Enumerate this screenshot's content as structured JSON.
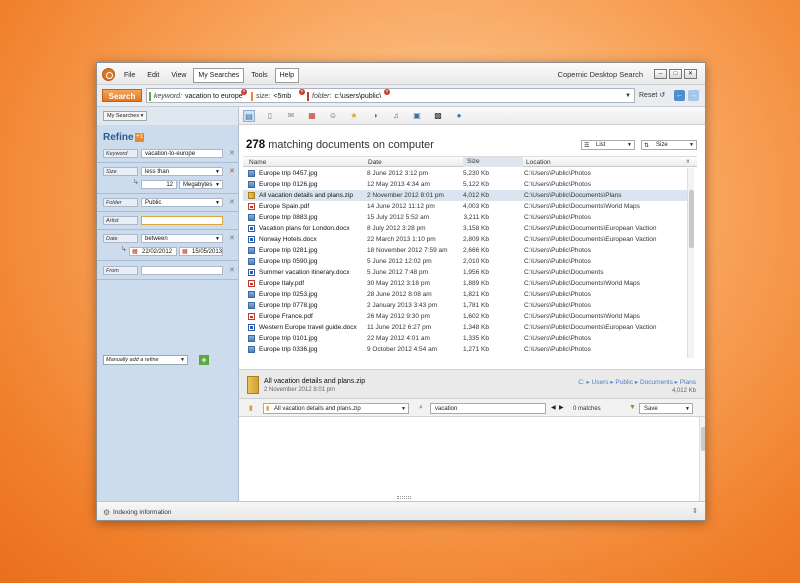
{
  "window": {
    "title": "Copernic Desktop Search",
    "menu": [
      "File",
      "Edit",
      "View",
      "My Searches",
      "Tools",
      "Help"
    ]
  },
  "search": {
    "button": "Search",
    "chips": [
      {
        "key": "keyword:",
        "value": "vacation to europe"
      },
      {
        "key": "size:",
        "value": "<5mb"
      },
      {
        "key": "folder:",
        "value": "c:\\users\\public\\"
      }
    ],
    "reset": "Reset"
  },
  "my_searches": "My Searches",
  "toolbar_icons": [
    "all-icon",
    "documents-icon",
    "emails-icon",
    "calendar-icon",
    "contacts-icon",
    "favorites-icon",
    "history-icon",
    "music-icon",
    "pictures-icon",
    "videos-icon",
    "web-icon"
  ],
  "refine": {
    "title": "Refine",
    "badge": "+1",
    "keyword": {
      "label": "Keyword",
      "value": "vacation-to-europe"
    },
    "size": {
      "label": "Size",
      "op": "less than",
      "amount": "12",
      "unit": "Megabytes"
    },
    "folder": {
      "label": "Folder",
      "value": "Public"
    },
    "artist": {
      "label": "Artist",
      "value": ""
    },
    "date": {
      "label": "Date",
      "op": "between",
      "from": "22/02/2012",
      "to": "15/05/2013"
    },
    "from": {
      "label": "From",
      "value": ""
    },
    "add": "Manually add a refine"
  },
  "results": {
    "count": "278",
    "count_text": "matching documents on computer",
    "view": "List",
    "sort": "Size",
    "columns": {
      "name": "Name",
      "date": "Date",
      "size": "Size",
      "location": "Location"
    },
    "rows": [
      {
        "type": "jpg",
        "name": "Europe trip 0457.jpg",
        "date": "8 June 2012  3:12 pm",
        "size": "5,230 Kb",
        "location": "C:\\Users\\Public\\Photos"
      },
      {
        "type": "jpg",
        "name": "Europe trip 0126.jpg",
        "date": "12 May 2013  4:34 am",
        "size": "5,122 Kb",
        "location": "C:\\Users\\Public\\Photos"
      },
      {
        "type": "zip",
        "name": "All vacation details and plans.zip",
        "date": "2 November 2012  8:01 pm",
        "size": "4,012 Kb",
        "location": "C:\\Users\\Public\\Documents\\Plans"
      },
      {
        "type": "pdf",
        "name": "Europe Spain.pdf",
        "date": "14 June 2012  11:12 pm",
        "size": "4,003 Kb",
        "location": "C:\\Users\\Public\\Documents\\World Maps"
      },
      {
        "type": "jpg",
        "name": "Europe trip 0883.jpg",
        "date": "15 July 2012  5:52 am",
        "size": "3,211 Kb",
        "location": "C:\\Users\\Public\\Photos"
      },
      {
        "type": "doc",
        "name": "Vacation plans for London.docx",
        "date": "8 July 2012  3:28 pm",
        "size": "3,158 Kb",
        "location": "C:\\Users\\Public\\Documents\\European Vaction"
      },
      {
        "type": "doc",
        "name": "Norway Hotels.docx",
        "date": "22 March 2013  1:10 pm",
        "size": "2,809 Kb",
        "location": "C:\\Users\\Public\\Documents\\European Vaction"
      },
      {
        "type": "jpg",
        "name": "Europe trip 0281.jpg",
        "date": "18 November 2012  7:59 am",
        "size": "2,666 Kb",
        "location": "C:\\Users\\Public\\Photos"
      },
      {
        "type": "jpg",
        "name": "Europe trip 0590.jpg",
        "date": "5 June 2012  12:02 pm",
        "size": "2,010 Kb",
        "location": "C:\\Users\\Public\\Photos"
      },
      {
        "type": "doc",
        "name": "Summer vacation itinerary.docx",
        "date": "5 June 2012  7:48 pm",
        "size": "1,956 Kb",
        "location": "C:\\Users\\Public\\Documents"
      },
      {
        "type": "pdf",
        "name": "Europe Italy.pdf",
        "date": "30 May 2012  3:18 pm",
        "size": "1,889 Kb",
        "location": "C:\\Users\\Public\\Documents\\World Maps"
      },
      {
        "type": "jpg",
        "name": "Europe trip 0253.jpg",
        "date": "28 June 2012  8:08 am",
        "size": "1,821 Kb",
        "location": "C:\\Users\\Public\\Photos"
      },
      {
        "type": "jpg",
        "name": "Europe trip 0778.jpg",
        "date": "2 January 2013  3:43 pm",
        "size": "1,781 Kb",
        "location": "C:\\Users\\Public\\Photos"
      },
      {
        "type": "pdf",
        "name": "Europe France.pdf",
        "date": "26 May 2012  9:30 pm",
        "size": "1,602 Kb",
        "location": "C:\\Users\\Public\\Documents\\World Maps"
      },
      {
        "type": "doc",
        "name": "Western Europe travel guide.docx",
        "date": "11 June 2012  6:27 pm",
        "size": "1,348 Kb",
        "location": "C:\\Users\\Public\\Documents\\European Vaction"
      },
      {
        "type": "jpg",
        "name": "Europe trip 0101.jpg",
        "date": "22 May 2012  4:01 am",
        "size": "1,335 Kb",
        "location": "C:\\Users\\Public\\Photos"
      },
      {
        "type": "jpg",
        "name": "Europe trip 0336.jpg",
        "date": "9 October 2012  4:54 am",
        "size": "1,271 Kb",
        "location": "C:\\Users\\Public\\Photos"
      }
    ]
  },
  "preview": {
    "name": "All vacation details and plans.zip",
    "date": "2 November 2012  8:01 pm",
    "path": "C: ▸ Users ▸ Public ▸ Documents ▸ Plans",
    "size": "4,012 Kb",
    "file_select": "All vacation details and plans.zip",
    "find": "vacation",
    "matches": "0 matches",
    "save": "Save"
  },
  "status": {
    "text": "Indexing information"
  }
}
